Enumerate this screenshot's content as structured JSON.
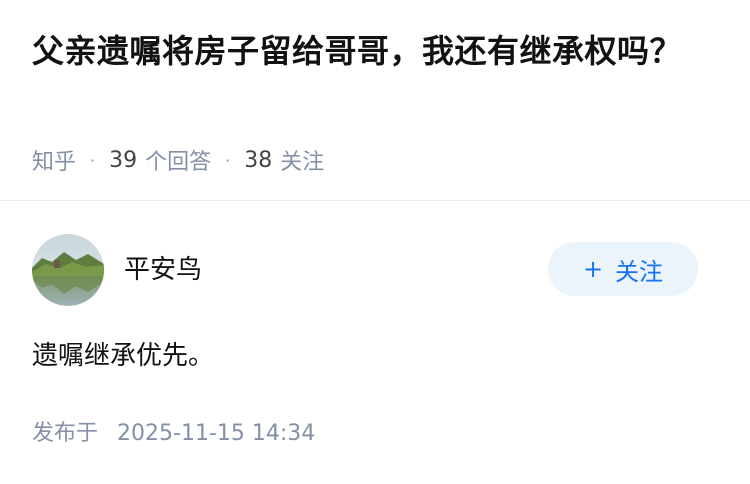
{
  "question": {
    "title": "父亲遗嘱将房子留给哥哥，我还有继承权吗？",
    "source": "知乎",
    "answers_count": "39",
    "answers_label": "个回答",
    "followers_count": "38",
    "followers_label": "关注"
  },
  "answer": {
    "author_name": "平安鸟",
    "follow_button_label": "关注",
    "content": "遗嘱继承优先。",
    "publish_label": "发布于",
    "publish_time": "2025-11-15 14:34"
  },
  "colors": {
    "accent": "#1772f6",
    "follow_button_bg": "#ebf3fb",
    "meta_text": "#8590a6",
    "title_text": "#121212"
  },
  "icons": {
    "follow": "plus-icon",
    "avatar": "landscape-avatar"
  }
}
